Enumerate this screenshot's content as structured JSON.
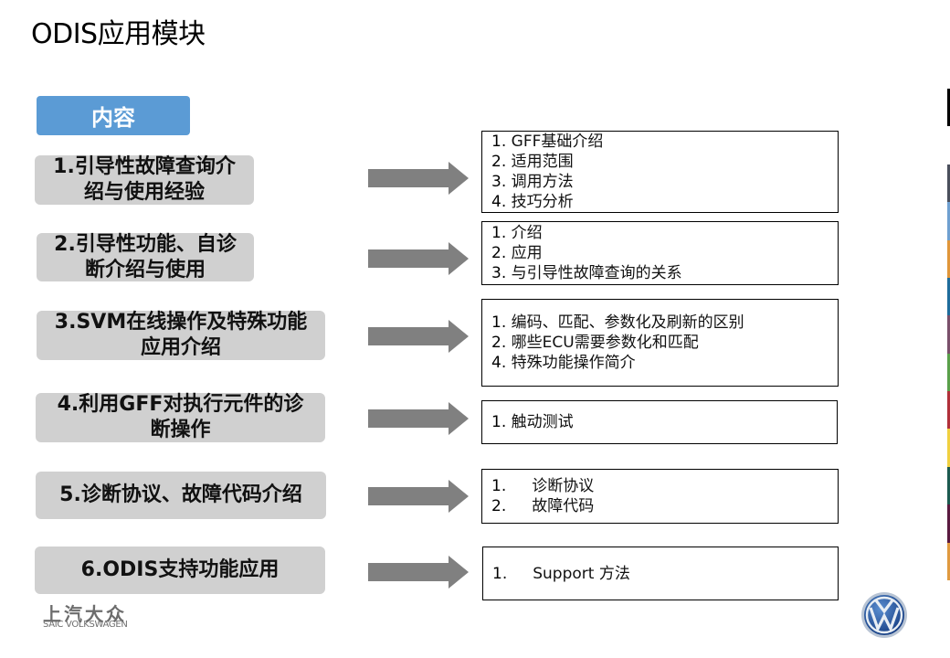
{
  "title": "ODIS应用模块",
  "content_label": "内容",
  "topics": [
    {
      "label": "1.引导性故障查询介\n绍与使用经验"
    },
    {
      "label": "2.引导性功能、自诊\n断介绍与使用"
    },
    {
      "label": "3.SVM在线操作及特殊功能\n应用介绍"
    },
    {
      "label": "4.利用GFF对执行元件的诊\n断操作"
    },
    {
      "label": "5.诊断协议、故障代码介绍"
    },
    {
      "label": "6.ODIS支持功能应用"
    }
  ],
  "details": [
    {
      "items": [
        {
          "num": "1.",
          "text": "GFF基础介绍"
        },
        {
          "num": "2.",
          "text": "适用范围"
        },
        {
          "num": "3.",
          "text": "调用方法"
        },
        {
          "num": "4.",
          "text": "技巧分析"
        }
      ]
    },
    {
      "items": [
        {
          "num": "1.",
          "text": "介绍"
        },
        {
          "num": "2.",
          "text": "应用"
        },
        {
          "num": "3.",
          "text": "与引导性故障查询的关系"
        }
      ]
    },
    {
      "items": [
        {
          "num": "1.",
          "text": "编码、匹配、参数化及刷新的区别"
        },
        {
          "num": "2.",
          "text": "哪些ECU需要参数化和匹配"
        },
        {
          "num": "4.",
          "text": "特殊功能操作简介"
        }
      ]
    },
    {
      "items": [
        {
          "num": "1.",
          "text": "触动测试"
        }
      ]
    },
    {
      "items": [
        {
          "num": "1.",
          "text": "诊断协议"
        },
        {
          "num": "2.",
          "text": "故障代码"
        }
      ]
    },
    {
      "items": [
        {
          "num": "1.",
          "text": "Support 方法"
        }
      ]
    }
  ],
  "brand": {
    "name_cn": "上汽大众",
    "name_en": "SAIC VOLKSWAGEN",
    "logo_icon": "vw-logo-icon"
  },
  "colors": {
    "badge": "#5b9bd5",
    "topic_bg": "#d0d0d0",
    "arrow": "#808080",
    "stripes": [
      "#000000",
      "#ffffff",
      "#4a4f5c",
      "#6fa0d0",
      "#e0963a",
      "#1f6c9c",
      "#7a4f6a",
      "#5aa04a",
      "#b0303a",
      "#f0d040",
      "#1c5a50",
      "#5a1a40",
      "#e09a40"
    ]
  }
}
